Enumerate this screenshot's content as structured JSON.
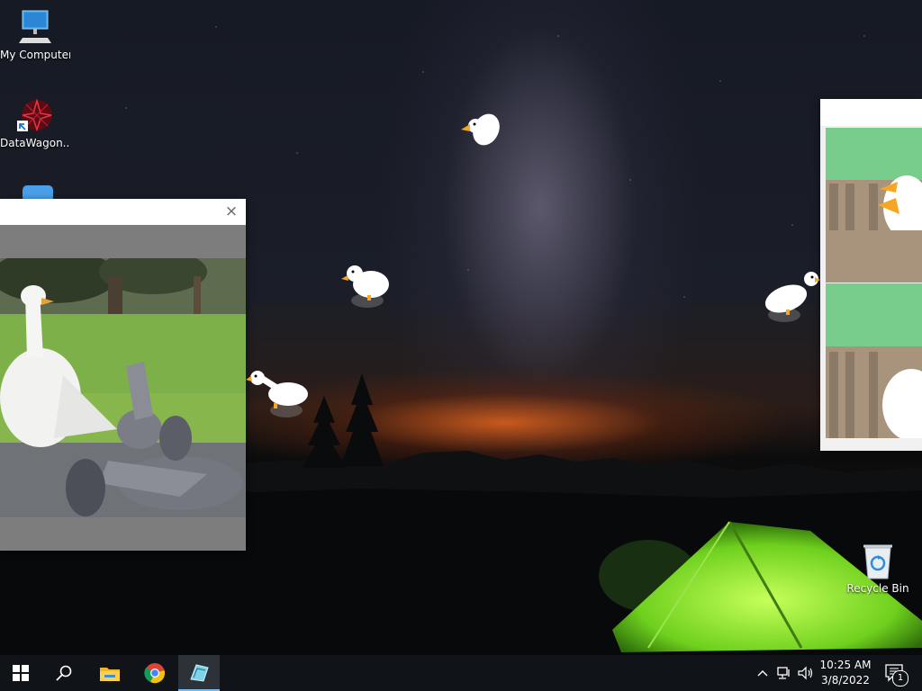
{
  "desktop": {
    "icons": [
      {
        "label": "My Computer",
        "icon": "computer-icon"
      },
      {
        "label": "DataWagon...",
        "icon": "datawagon-icon"
      },
      {
        "label": "",
        "icon": "partial-app-icon"
      },
      {
        "label": "Recycle Bin",
        "icon": "recycle-bin-icon"
      }
    ],
    "wallpaper": "night-sky-campsite"
  },
  "video_window": {
    "title": "",
    "close_glyph": "×",
    "content": "gif-goose-and-pigeons"
  },
  "right_window": {
    "title": "",
    "content": "goose-comic-panels"
  },
  "taskbar": {
    "start_icon": "windows-start-icon",
    "search_icon": "search-icon",
    "pinned": [
      "file-explorer-icon",
      "chrome-icon",
      "goose-app-icon"
    ],
    "tray": {
      "chevron": "^",
      "time": "10:25 AM",
      "date": "3/8/2022",
      "notification_count": "1"
    }
  },
  "colors": {
    "taskbar_bg": "#101318",
    "active_underline": "#76b9ed",
    "comic_green": "#78cc8c",
    "comic_wood": "#a8947c",
    "goose_beak": "#f5a623"
  }
}
